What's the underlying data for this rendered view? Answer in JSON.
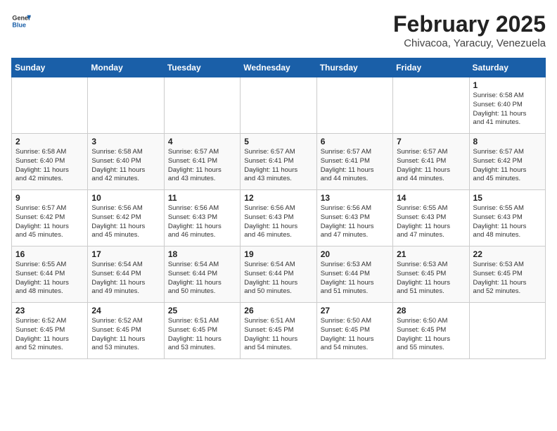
{
  "logo": {
    "text_general": "General",
    "text_blue": "Blue"
  },
  "calendar": {
    "title": "February 2025",
    "subtitle": "Chivacoa, Yaracuy, Venezuela"
  },
  "weekdays": [
    "Sunday",
    "Monday",
    "Tuesday",
    "Wednesday",
    "Thursday",
    "Friday",
    "Saturday"
  ],
  "weeks": [
    [
      {
        "day": "",
        "info": ""
      },
      {
        "day": "",
        "info": ""
      },
      {
        "day": "",
        "info": ""
      },
      {
        "day": "",
        "info": ""
      },
      {
        "day": "",
        "info": ""
      },
      {
        "day": "",
        "info": ""
      },
      {
        "day": "1",
        "info": "Sunrise: 6:58 AM\nSunset: 6:40 PM\nDaylight: 11 hours\nand 41 minutes."
      }
    ],
    [
      {
        "day": "2",
        "info": "Sunrise: 6:58 AM\nSunset: 6:40 PM\nDaylight: 11 hours\nand 42 minutes."
      },
      {
        "day": "3",
        "info": "Sunrise: 6:58 AM\nSunset: 6:40 PM\nDaylight: 11 hours\nand 42 minutes."
      },
      {
        "day": "4",
        "info": "Sunrise: 6:57 AM\nSunset: 6:41 PM\nDaylight: 11 hours\nand 43 minutes."
      },
      {
        "day": "5",
        "info": "Sunrise: 6:57 AM\nSunset: 6:41 PM\nDaylight: 11 hours\nand 43 minutes."
      },
      {
        "day": "6",
        "info": "Sunrise: 6:57 AM\nSunset: 6:41 PM\nDaylight: 11 hours\nand 44 minutes."
      },
      {
        "day": "7",
        "info": "Sunrise: 6:57 AM\nSunset: 6:41 PM\nDaylight: 11 hours\nand 44 minutes."
      },
      {
        "day": "8",
        "info": "Sunrise: 6:57 AM\nSunset: 6:42 PM\nDaylight: 11 hours\nand 45 minutes."
      }
    ],
    [
      {
        "day": "9",
        "info": "Sunrise: 6:57 AM\nSunset: 6:42 PM\nDaylight: 11 hours\nand 45 minutes."
      },
      {
        "day": "10",
        "info": "Sunrise: 6:56 AM\nSunset: 6:42 PM\nDaylight: 11 hours\nand 45 minutes."
      },
      {
        "day": "11",
        "info": "Sunrise: 6:56 AM\nSunset: 6:43 PM\nDaylight: 11 hours\nand 46 minutes."
      },
      {
        "day": "12",
        "info": "Sunrise: 6:56 AM\nSunset: 6:43 PM\nDaylight: 11 hours\nand 46 minutes."
      },
      {
        "day": "13",
        "info": "Sunrise: 6:56 AM\nSunset: 6:43 PM\nDaylight: 11 hours\nand 47 minutes."
      },
      {
        "day": "14",
        "info": "Sunrise: 6:55 AM\nSunset: 6:43 PM\nDaylight: 11 hours\nand 47 minutes."
      },
      {
        "day": "15",
        "info": "Sunrise: 6:55 AM\nSunset: 6:43 PM\nDaylight: 11 hours\nand 48 minutes."
      }
    ],
    [
      {
        "day": "16",
        "info": "Sunrise: 6:55 AM\nSunset: 6:44 PM\nDaylight: 11 hours\nand 48 minutes."
      },
      {
        "day": "17",
        "info": "Sunrise: 6:54 AM\nSunset: 6:44 PM\nDaylight: 11 hours\nand 49 minutes."
      },
      {
        "day": "18",
        "info": "Sunrise: 6:54 AM\nSunset: 6:44 PM\nDaylight: 11 hours\nand 50 minutes."
      },
      {
        "day": "19",
        "info": "Sunrise: 6:54 AM\nSunset: 6:44 PM\nDaylight: 11 hours\nand 50 minutes."
      },
      {
        "day": "20",
        "info": "Sunrise: 6:53 AM\nSunset: 6:44 PM\nDaylight: 11 hours\nand 51 minutes."
      },
      {
        "day": "21",
        "info": "Sunrise: 6:53 AM\nSunset: 6:45 PM\nDaylight: 11 hours\nand 51 minutes."
      },
      {
        "day": "22",
        "info": "Sunrise: 6:53 AM\nSunset: 6:45 PM\nDaylight: 11 hours\nand 52 minutes."
      }
    ],
    [
      {
        "day": "23",
        "info": "Sunrise: 6:52 AM\nSunset: 6:45 PM\nDaylight: 11 hours\nand 52 minutes."
      },
      {
        "day": "24",
        "info": "Sunrise: 6:52 AM\nSunset: 6:45 PM\nDaylight: 11 hours\nand 53 minutes."
      },
      {
        "day": "25",
        "info": "Sunrise: 6:51 AM\nSunset: 6:45 PM\nDaylight: 11 hours\nand 53 minutes."
      },
      {
        "day": "26",
        "info": "Sunrise: 6:51 AM\nSunset: 6:45 PM\nDaylight: 11 hours\nand 54 minutes."
      },
      {
        "day": "27",
        "info": "Sunrise: 6:50 AM\nSunset: 6:45 PM\nDaylight: 11 hours\nand 54 minutes."
      },
      {
        "day": "28",
        "info": "Sunrise: 6:50 AM\nSunset: 6:45 PM\nDaylight: 11 hours\nand 55 minutes."
      },
      {
        "day": "",
        "info": ""
      }
    ]
  ]
}
